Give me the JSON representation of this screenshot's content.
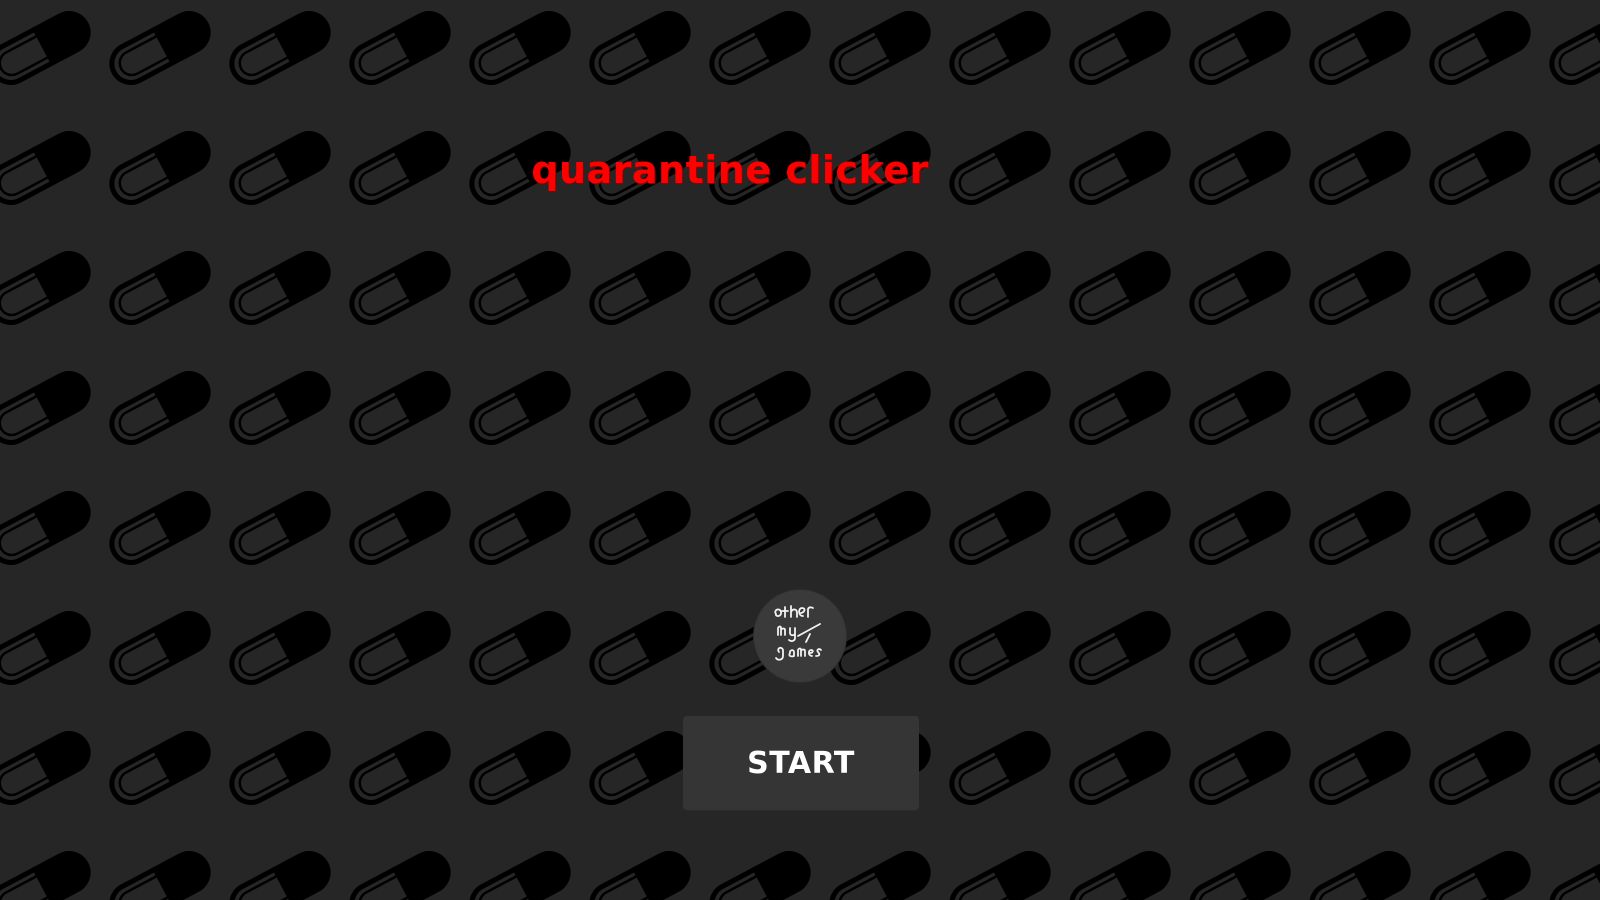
{
  "game": {
    "title": "quarantine clicker",
    "start_label": "START",
    "other_games_logo_text": "other my games",
    "background_icon": "pill-capsule-icon",
    "other_games_icon": "other-games-logo-icon"
  },
  "colors": {
    "background": "#262626",
    "pill": "#000000",
    "title": "#ff0000",
    "button": "#353535",
    "button_text": "#ffffff"
  }
}
